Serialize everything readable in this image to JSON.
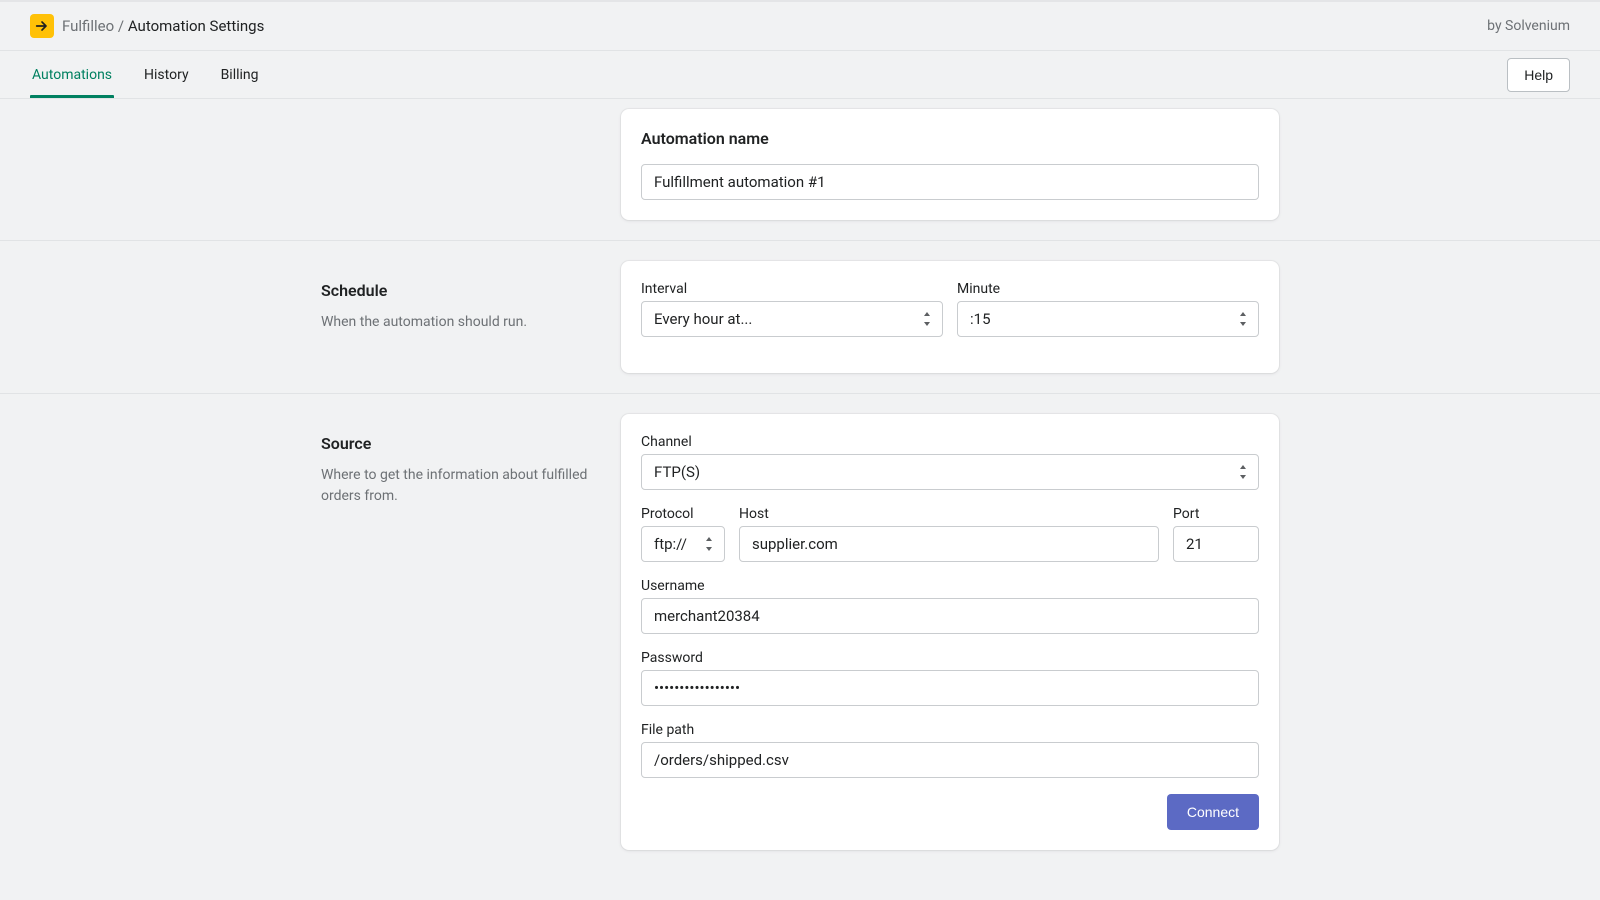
{
  "header": {
    "app_name": "Fulfilleo",
    "separator": "/",
    "page_title": "Automation Settings",
    "byline": "by Solvenium"
  },
  "tabs": {
    "items": [
      {
        "label": "Automations",
        "active": true
      },
      {
        "label": "History",
        "active": false
      },
      {
        "label": "Billing",
        "active": false
      }
    ],
    "help_label": "Help"
  },
  "name_card": {
    "title": "Automation name",
    "value": "Fulfillment automation #1"
  },
  "schedule": {
    "heading": "Schedule",
    "description": "When the automation should run.",
    "interval_label": "Interval",
    "interval_value": "Every hour at...",
    "minute_label": "Minute",
    "minute_value": ":15"
  },
  "source": {
    "heading": "Source",
    "description": "Where to get the information about fulfilled orders from.",
    "channel_label": "Channel",
    "channel_value": "FTP(S)",
    "protocol_label": "Protocol",
    "protocol_value": "ftp://",
    "host_label": "Host",
    "host_value": "supplier.com",
    "port_label": "Port",
    "port_value": "21",
    "username_label": "Username",
    "username_value": "merchant20384",
    "password_label": "Password",
    "password_value": "•••••••••••••••••",
    "filepath_label": "File path",
    "filepath_value": "/orders/shipped.csv",
    "connect_label": "Connect"
  }
}
